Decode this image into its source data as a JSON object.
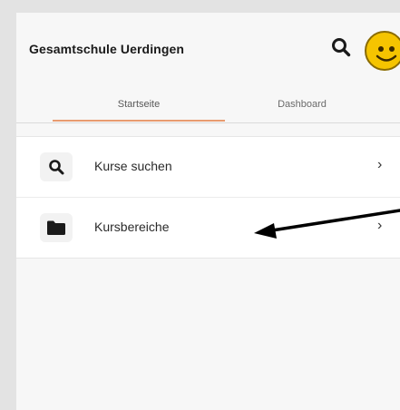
{
  "header": {
    "site_title": "Gesamtschule Uerdingen",
    "search_icon": "search-icon",
    "avatar_icon": "smiley-avatar"
  },
  "tabs": [
    {
      "label": "Startseite",
      "active": true
    },
    {
      "label": "Dashboard",
      "active": false
    }
  ],
  "list": [
    {
      "label": "Kurse suchen",
      "icon": "search-icon",
      "chevron": "›"
    },
    {
      "label": "Kursbereiche",
      "icon": "folder-icon",
      "chevron": "›"
    }
  ],
  "colors": {
    "active_tab_underline": "#e89b70",
    "avatar_fill": "#f5c400",
    "annotation_arrow": "#000000"
  }
}
